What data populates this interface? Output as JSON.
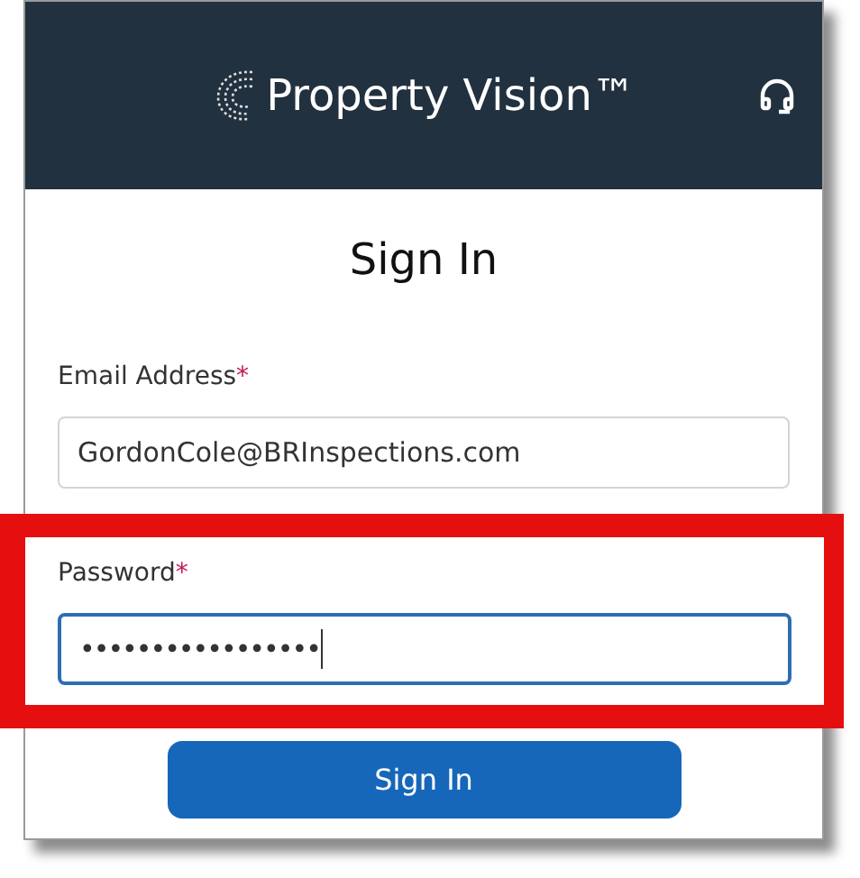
{
  "header": {
    "brand": "Property Vision™"
  },
  "title": "Sign In",
  "fields": [
    {
      "kind": "text",
      "label": "Email Address",
      "required_mark": "*",
      "value": "GordonCole@BRInspections.com",
      "focused": false,
      "highlighted": false
    },
    {
      "kind": "password",
      "label": "Password",
      "required_mark": "*",
      "value": "•••••••••••••••••",
      "focused": true,
      "highlighted": true
    }
  ],
  "buttons": [
    "Sign In"
  ]
}
